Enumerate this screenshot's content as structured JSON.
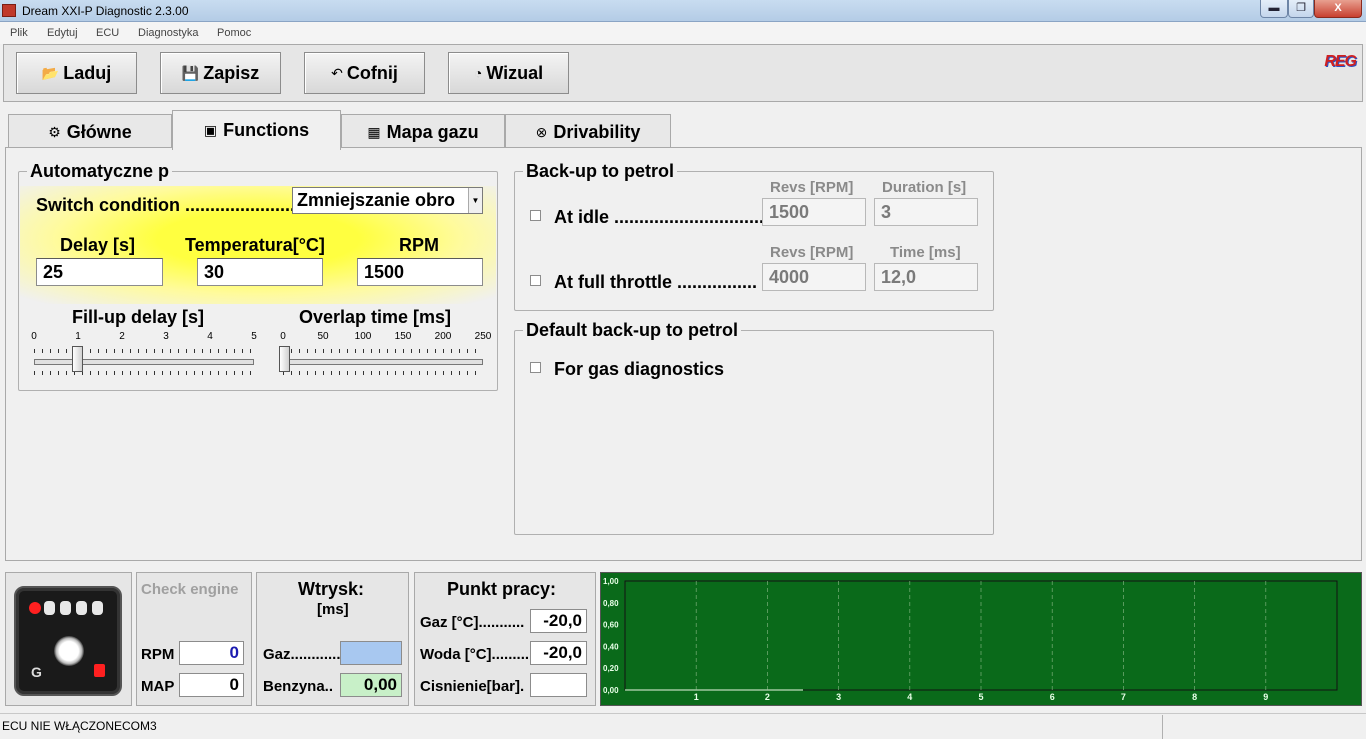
{
  "window": {
    "title": "Dream XXI-P Diagnostic 2.3.00",
    "min": "▬",
    "max": "❐",
    "close": "X"
  },
  "menu": [
    "Plik",
    "Edytuj",
    "ECU",
    "Diagnostyka",
    "Pomoc"
  ],
  "toolbar": {
    "load": "Laduj",
    "save": "Zapisz",
    "undo": "Cofnij",
    "visual": "Wizual",
    "logo": "REG"
  },
  "tabs": [
    {
      "label": "Główne",
      "icon": "gear-icon"
    },
    {
      "label": "Functions",
      "icon": "chip-icon"
    },
    {
      "label": "Mapa gazu",
      "icon": "grid-icon"
    },
    {
      "label": "Drivability",
      "icon": "wheel-icon"
    }
  ],
  "auto": {
    "title": "Automatyczne p",
    "switch_label": "Switch condition ......................",
    "switch_value": "Zmniejszanie obro",
    "delay_label": "Delay [s]",
    "delay_value": "25",
    "temp_label": "Temperatura[°C]",
    "temp_value": "30",
    "rpm_label": "RPM",
    "rpm_value": "1500",
    "fill_label": "Fill-up delay [s]",
    "fill_scale": [
      "0",
      "1",
      "2",
      "3",
      "4",
      "5"
    ],
    "fill_value": 0.5,
    "overlap_label": "Overlap time [ms]",
    "overlap_scale": [
      "0",
      "50",
      "100",
      "150",
      "200",
      "250"
    ],
    "overlap_value": 0
  },
  "backup": {
    "title": "Back-up to petrol",
    "idle_label": "At idle ...............................",
    "revs_label": "Revs [RPM]",
    "duration_label": "Duration [s]",
    "idle_revs": "1500",
    "idle_duration": "3",
    "full_label": "At full throttle ................",
    "revs_label2": "Revs [RPM]",
    "time_label": "Time [ms]",
    "full_revs": "4000",
    "full_time": "12,0"
  },
  "default_backup": {
    "title": "Default back-up to petrol",
    "diag_label": "For gas diagnostics"
  },
  "status_panel": {
    "check_engine": "Check engine",
    "rpm_label": "RPM",
    "rpm_value": "0",
    "map_label": "MAP",
    "map_value": "0",
    "device_g": "G"
  },
  "injection": {
    "title": "Wtrysk:",
    "unit": "[ms]",
    "gas_label": "Gaz............",
    "gas_value": "",
    "petrol_label": "Benzyna..",
    "petrol_value": "0,00"
  },
  "workpoint": {
    "title": "Punkt pracy:",
    "gas_label": "Gaz [°C]...........",
    "gas_value": "-20,0",
    "water_label": "Woda [°C].........",
    "water_value": "-20,0",
    "pressure_label": "Cisnienie[bar].",
    "pressure_value": ""
  },
  "chart_data": {
    "type": "line",
    "x_ticks": [
      "1",
      "2",
      "3",
      "4",
      "5",
      "6",
      "7",
      "8",
      "9"
    ],
    "y_ticks": [
      "0,00",
      "0,20",
      "0,40",
      "0,60",
      "0,80",
      "1,00"
    ],
    "ylim": [
      0,
      1
    ],
    "xlim": [
      0,
      10
    ],
    "grid": true,
    "series": [
      {
        "values": [
          [
            0,
            0
          ],
          [
            2.5,
            0
          ]
        ],
        "color": "#a0c8a0"
      }
    ],
    "bg": "#0a6a1a"
  },
  "statusbar": {
    "text": "ECU NIE WŁĄCZONECOM3"
  }
}
